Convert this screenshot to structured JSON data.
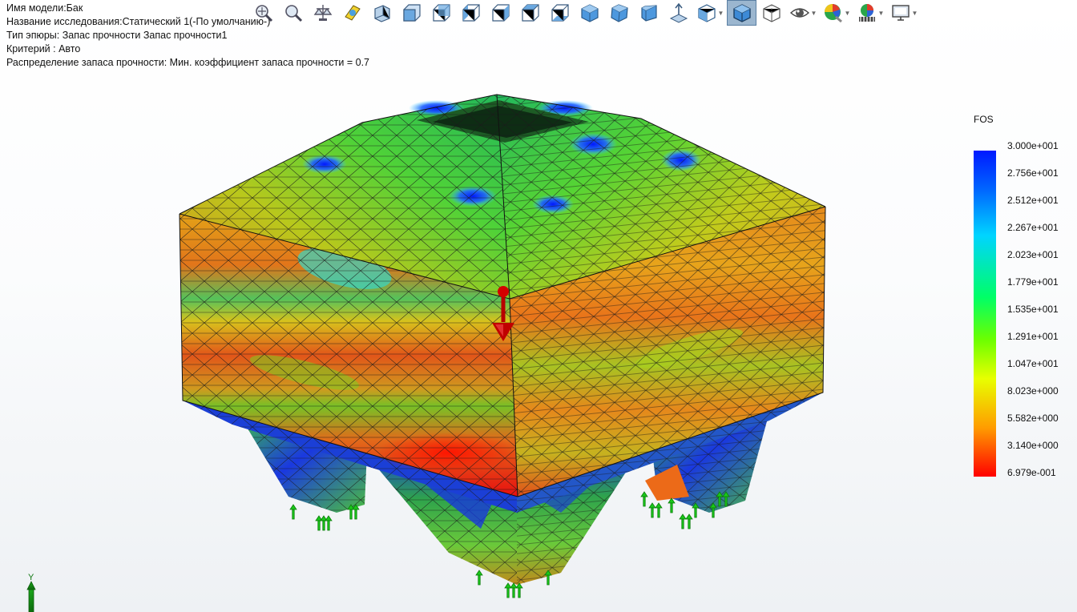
{
  "info": {
    "lines": [
      "Имя модели:Бак",
      "Название исследования:Статический 1(-По умолчанию-)",
      "Тип эпюры: Запас прочности Запас прочности1",
      "Критерий : Авто",
      "Распределение запаса прочности: Мин. коэффициент запаса прочности = 0.7"
    ]
  },
  "legend": {
    "title": "FOS",
    "labels": [
      "3.000e+001",
      "2.756e+001",
      "2.512e+001",
      "2.267e+001",
      "2.023e+001",
      "1.779e+001",
      "1.535e+001",
      "1.291e+001",
      "1.047e+001",
      "8.023e+000",
      "5.582e+000",
      "3.140e+000",
      "6.979e-001"
    ],
    "colors": [
      "#0019ff",
      "#00d4ff",
      "#00ff66",
      "#e8ff00",
      "#ff9c00",
      "#ff0000"
    ]
  },
  "toolbar": {
    "icons": [
      "zoom-to-fit-icon",
      "zoom-area-icon",
      "previous-view-icon",
      "section-view-icon",
      "dynamic-annotation-icon",
      "view-front-icon",
      "view-back-icon",
      "view-left-icon",
      "view-right-icon",
      "view-top-icon",
      "view-bottom-icon",
      "view-isometric-icon",
      "view-trimetric-icon",
      "view-dimetric-icon",
      "normal-to-icon",
      "view-orientation-icon",
      "display-style-icon",
      "hidden-lines-icon",
      "hide-show-items-icon",
      "edit-appearance-icon",
      "apply-scene-icon",
      "view-settings-icon"
    ],
    "active": "display-style-icon"
  },
  "triad": {
    "y_label": "Y"
  },
  "model": {
    "max_color": "#0019ff",
    "min_color": "#ff0000"
  }
}
